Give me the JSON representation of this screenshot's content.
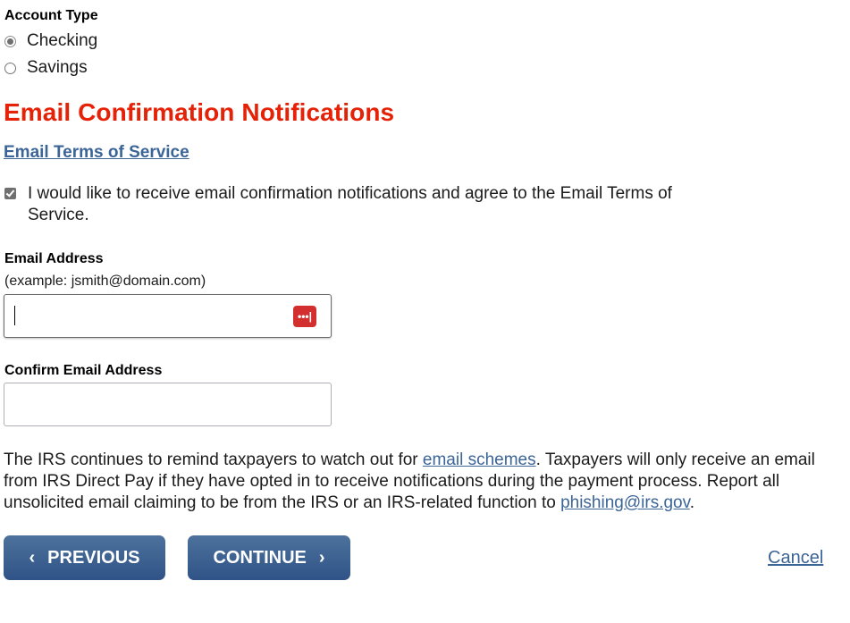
{
  "account_type": {
    "label": "Account Type",
    "options": [
      {
        "label": "Checking",
        "selected": true
      },
      {
        "label": "Savings",
        "selected": false
      }
    ]
  },
  "email_section": {
    "heading": "Email Confirmation Notifications",
    "tos_link": "Email Terms of Service",
    "consent_checkbox": {
      "checked": true,
      "label": "I would like to receive email confirmation notifications and agree to the Email Terms of Service."
    },
    "email_field": {
      "label": "Email Address",
      "hint": "(example: jsmith@domain.com)",
      "value": "",
      "password_manager_icon": "password-manager-icon"
    },
    "confirm_email_field": {
      "label": "Confirm Email Address",
      "value": ""
    }
  },
  "notice": {
    "text_1": "The IRS continues to remind taxpayers to watch out for ",
    "link_1": "email schemes",
    "text_2": ". Taxpayers will only receive an email from IRS Direct Pay if they have opted in to receive notifications during the payment process. Report all unsolicited email claiming to be from the IRS or an IRS-related function to ",
    "link_2": "phishing@irs.gov",
    "text_3": "."
  },
  "actions": {
    "previous_label": "PREVIOUS",
    "previous_icon": "‹",
    "continue_label": "CONTINUE",
    "continue_icon": "›",
    "cancel_label": "Cancel"
  },
  "colors": {
    "heading": "#e52207",
    "link": "#3b6497",
    "button": "#3f6391"
  }
}
